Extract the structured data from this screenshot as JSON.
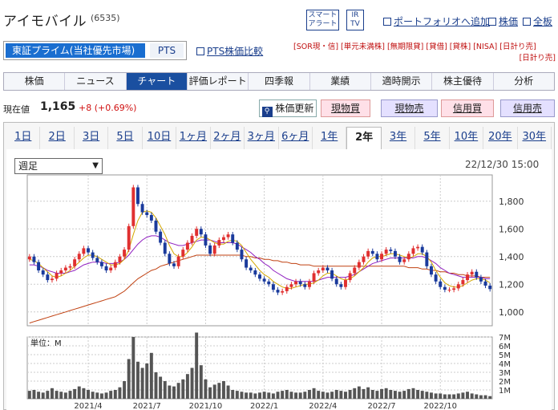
{
  "header": {
    "company": "アイモバイル",
    "code": "(6535)",
    "alert_btn": [
      "スマート",
      "アラート"
    ],
    "irtv_btn": [
      "IR",
      "TV"
    ],
    "links": [
      "ポートフォリオへ追加",
      "株価",
      "全板"
    ]
  },
  "market": {
    "primary": "東証プライム(当社優先市場)",
    "pts": "PTS",
    "pts_link": "PTS株価比較"
  },
  "badges": [
    "[SOR現・信]",
    "[単元未満株]",
    "[無期限貸]",
    "[貸借]",
    "[貸株]",
    "[NISA]",
    "[日計り売]",
    "[日計り売]"
  ],
  "nav": [
    "株価",
    "ニュース",
    "チャート",
    "評価レポート",
    "四季報",
    "業績",
    "適時開示",
    "株主優待",
    "分析"
  ],
  "nav_active": 2,
  "price": {
    "label": "現在値",
    "value": "1,165",
    "change": "+8 (+0.69%)"
  },
  "actions": {
    "update": "株価更新",
    "genbutsu_buy": "現物買",
    "genbutsu_sell": "現物売",
    "shinyo_buy": "信用買",
    "shinyo_sell": "信用売"
  },
  "periods": [
    "1日",
    "2日",
    "3日",
    "5日",
    "10日",
    "1ヶ月",
    "2ヶ月",
    "3ヶ月",
    "6ヶ月",
    "1年",
    "2年",
    "3年",
    "5年",
    "10年",
    "20年",
    "30年"
  ],
  "period_active": 10,
  "chart_select": "週足",
  "datestamp": "22/12/30 15:00",
  "volume_unit": "単位：M",
  "colors": {
    "up": "#e03030",
    "down": "#1a3a9c",
    "ma_short": "#d4a800",
    "ma_mid": "#9020c0",
    "ma_long": "#c04010",
    "volume": "#555555"
  },
  "chart_data": {
    "type": "candlestick",
    "price_axis": {
      "ticks": [
        1000,
        1200,
        1400,
        1600,
        1800
      ],
      "tick_labels": [
        "1,000",
        "1,200",
        "1,400",
        "1,600",
        "1,800"
      ],
      "ylim": [
        900,
        1990
      ]
    },
    "volume_axis": {
      "ticks": [
        1,
        2,
        3,
        4,
        5,
        6,
        7
      ],
      "tick_labels": [
        "1M",
        "2M",
        "3M",
        "4M",
        "5M",
        "6M",
        "7M"
      ],
      "ylim": [
        0,
        7
      ]
    },
    "x_labels": [
      {
        "label": "2021/4",
        "index": 13
      },
      {
        "label": "2021/7",
        "index": 26
      },
      {
        "label": "2021/10",
        "index": 39
      },
      {
        "label": "2022/1",
        "index": 52
      },
      {
        "label": "2022/4",
        "index": 65
      },
      {
        "label": "2022/7",
        "index": 78
      },
      {
        "label": "2022/10",
        "index": 91
      }
    ],
    "close": [
      1400,
      1360,
      1300,
      1270,
      1230,
      1240,
      1280,
      1300,
      1320,
      1330,
      1380,
      1420,
      1460,
      1430,
      1390,
      1360,
      1330,
      1300,
      1320,
      1360,
      1400,
      1450,
      1620,
      1900,
      1780,
      1720,
      1700,
      1660,
      1580,
      1500,
      1420,
      1350,
      1330,
      1400,
      1450,
      1500,
      1550,
      1600,
      1560,
      1480,
      1420,
      1480,
      1520,
      1540,
      1560,
      1500,
      1450,
      1380,
      1320,
      1300,
      1270,
      1240,
      1220,
      1200,
      1160,
      1140,
      1150,
      1180,
      1200,
      1220,
      1200,
      1180,
      1220,
      1280,
      1300,
      1320,
      1300,
      1240,
      1200,
      1180,
      1230,
      1280,
      1320,
      1360,
      1400,
      1440,
      1420,
      1380,
      1420,
      1450,
      1440,
      1400,
      1360,
      1380,
      1420,
      1460,
      1470,
      1430,
      1330,
      1270,
      1220,
      1180,
      1160,
      1160,
      1170,
      1200,
      1230,
      1270,
      1290,
      1250,
      1220,
      1190,
      1165
    ],
    "ma_short": [
      1380,
      1370,
      1350,
      1320,
      1290,
      1260,
      1250,
      1260,
      1280,
      1300,
      1330,
      1360,
      1390,
      1410,
      1410,
      1400,
      1380,
      1360,
      1340,
      1340,
      1350,
      1380,
      1450,
      1560,
      1660,
      1720,
      1730,
      1720,
      1680,
      1620,
      1560,
      1480,
      1420,
      1400,
      1400,
      1430,
      1470,
      1520,
      1540,
      1540,
      1520,
      1500,
      1490,
      1490,
      1510,
      1520,
      1510,
      1480,
      1430,
      1380,
      1340,
      1300,
      1270,
      1250,
      1220,
      1200,
      1180,
      1170,
      1170,
      1180,
      1190,
      1200,
      1200,
      1210,
      1230,
      1260,
      1280,
      1280,
      1260,
      1240,
      1230,
      1240,
      1260,
      1290,
      1320,
      1360,
      1390,
      1400,
      1400,
      1410,
      1420,
      1420,
      1410,
      1400,
      1390,
      1400,
      1420,
      1420,
      1400,
      1360,
      1300,
      1250,
      1210,
      1190,
      1180,
      1180,
      1190,
      1210,
      1230,
      1240,
      1240,
      1230,
      1210
    ],
    "ma_mid": [
      1340,
      1340,
      1330,
      1320,
      1300,
      1290,
      1280,
      1280,
      1280,
      1290,
      1300,
      1320,
      1340,
      1350,
      1360,
      1360,
      1360,
      1350,
      1350,
      1350,
      1360,
      1380,
      1410,
      1450,
      1490,
      1520,
      1540,
      1550,
      1550,
      1540,
      1520,
      1500,
      1490,
      1480,
      1480,
      1490,
      1500,
      1510,
      1520,
      1520,
      1520,
      1510,
      1500,
      1500,
      1500,
      1500,
      1490,
      1470,
      1450,
      1430,
      1400,
      1380,
      1350,
      1330,
      1300,
      1280,
      1260,
      1240,
      1230,
      1220,
      1220,
      1220,
      1220,
      1220,
      1230,
      1240,
      1250,
      1250,
      1250,
      1250,
      1250,
      1260,
      1270,
      1290,
      1310,
      1330,
      1350,
      1360,
      1370,
      1380,
      1390,
      1390,
      1390,
      1390,
      1390,
      1390,
      1400,
      1400,
      1390,
      1370,
      1350,
      1320,
      1300,
      1280,
      1270,
      1260,
      1250,
      1250,
      1250,
      1250,
      1250,
      1240,
      1240
    ],
    "ma_long": [
      920,
      930,
      940,
      950,
      960,
      970,
      980,
      990,
      1000,
      1010,
      1020,
      1030,
      1040,
      1050,
      1060,
      1070,
      1080,
      1090,
      1100,
      1110,
      1130,
      1150,
      1180,
      1210,
      1240,
      1260,
      1280,
      1300,
      1310,
      1330,
      1340,
      1350,
      1360,
      1370,
      1380,
      1390,
      1400,
      1410,
      1410,
      1410,
      1410,
      1410,
      1410,
      1410,
      1410,
      1410,
      1410,
      1410,
      1400,
      1400,
      1390,
      1390,
      1380,
      1380,
      1370,
      1370,
      1360,
      1360,
      1350,
      1350,
      1340,
      1340,
      1340,
      1330,
      1330,
      1330,
      1330,
      1330,
      1330,
      1330,
      1330,
      1330,
      1330,
      1330,
      1330,
      1330,
      1330,
      1330,
      1330,
      1330,
      1330,
      1330,
      1330,
      1330,
      1320,
      1320,
      1320,
      1310,
      1310,
      1300,
      1300,
      1290,
      1290,
      1280,
      1280,
      1270,
      1270,
      1260,
      1260,
      1260,
      1250,
      1250,
      1250
    ],
    "volume": [
      0.9,
      1.0,
      0.8,
      0.7,
      0.9,
      1.2,
      0.9,
      0.8,
      0.7,
      0.9,
      1.1,
      1.4,
      1.2,
      1.0,
      0.8,
      0.7,
      0.6,
      0.7,
      0.9,
      1.0,
      1.3,
      2.0,
      4.5,
      7.0,
      4.2,
      3.5,
      4.0,
      5.2,
      3.0,
      2.5,
      2.0,
      1.5,
      1.4,
      1.8,
      2.2,
      2.8,
      3.5,
      7.5,
      3.8,
      2.2,
      1.3,
      1.6,
      1.8,
      2.0,
      1.5,
      1.0,
      0.9,
      0.8,
      0.7,
      0.7,
      0.6,
      0.7,
      0.8,
      0.7,
      0.6,
      0.8,
      0.9,
      1.0,
      0.8,
      0.7,
      0.7,
      0.8,
      1.0,
      1.2,
      0.9,
      0.8,
      0.7,
      0.8,
      1.0,
      0.9,
      0.8,
      1.0,
      1.2,
      1.4,
      1.1,
      1.3,
      1.0,
      0.9,
      1.1,
      1.2,
      1.0,
      0.9,
      0.8,
      0.9,
      1.1,
      1.2,
      1.0,
      0.9,
      0.8,
      0.7,
      0.6,
      0.6,
      0.5,
      0.5,
      0.5,
      0.6,
      0.7,
      0.8,
      0.6,
      0.5,
      0.4,
      0.4,
      0.3
    ]
  }
}
